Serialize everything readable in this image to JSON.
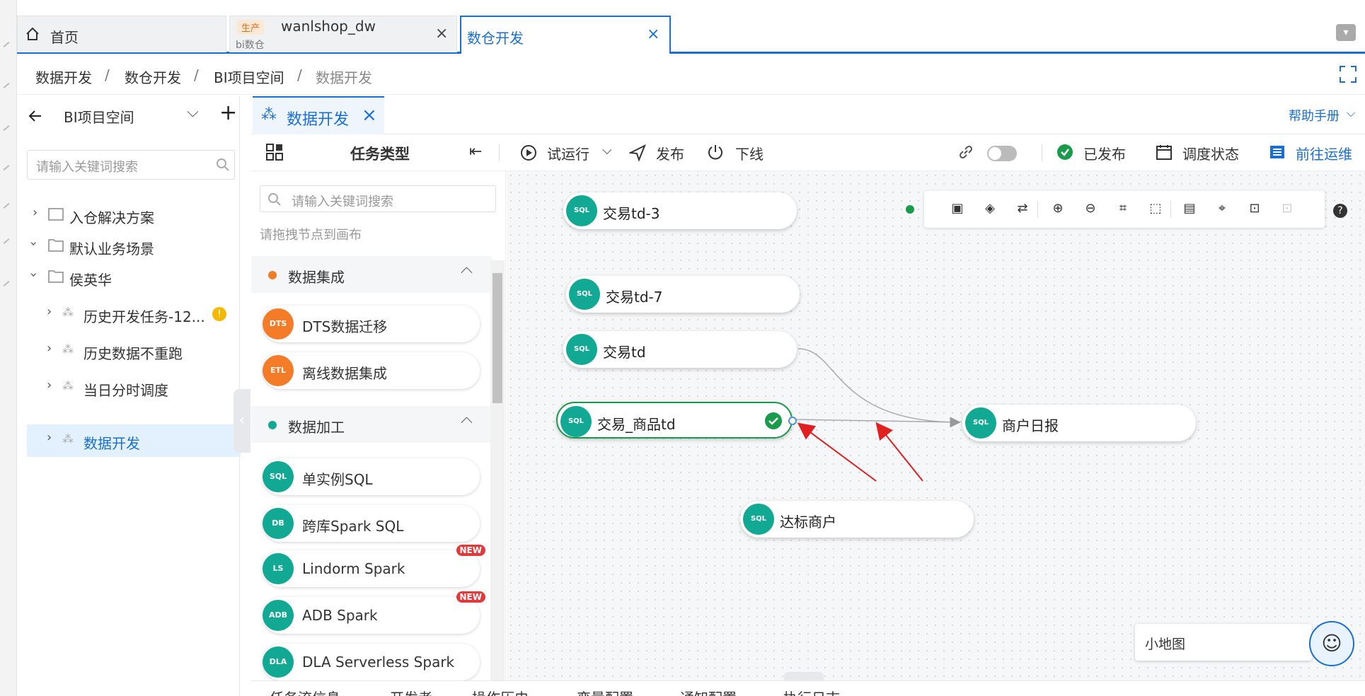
{
  "tabs": {
    "home": "首页",
    "env_badge": "生产",
    "project_name": "wanlshop_dw",
    "project_sub": "bi数仓",
    "active": "数仓开发"
  },
  "breadcrumb": [
    "数据开发",
    "数仓开发",
    "BI项目空间",
    "数据开发"
  ],
  "sidebar": {
    "workspace": "BI项目空间",
    "search_placeholder": "请输入关键词搜索",
    "items": [
      {
        "label": "入仓解决方案"
      },
      {
        "label": "默认业务场景"
      },
      {
        "label": "侯英华"
      },
      {
        "label": "历史开发任务-12..."
      },
      {
        "label": "历史数据不重跑"
      },
      {
        "label": "当日分时调度"
      },
      {
        "label": "数据开发"
      }
    ]
  },
  "work_tab": "数据开发",
  "help": "帮助手册",
  "toolbar": {
    "task_type": "任务类型",
    "trial_run": "试运行",
    "publish": "发布",
    "offline": "下线",
    "published": "已发布",
    "schedule_status": "调度状态",
    "goto_ops": "前往运维"
  },
  "palette": {
    "search_placeholder": "请输入关键词搜索",
    "hint": "请拖拽节点到画布",
    "groups": [
      {
        "title": "数据集成",
        "color": "#f47c28",
        "items": [
          {
            "label": "DTS数据迁移"
          },
          {
            "label": "离线数据集成"
          }
        ]
      },
      {
        "title": "数据加工",
        "color": "#11a894",
        "items": [
          {
            "label": "单实例SQL"
          },
          {
            "label": "跨库Spark SQL"
          },
          {
            "label": "Lindorm Spark",
            "badge": "NEW"
          },
          {
            "label": "ADB Spark",
            "badge": "NEW"
          },
          {
            "label": "DLA Serverless Spark"
          }
        ]
      }
    ]
  },
  "canvas": {
    "nodes": [
      {
        "label": "交易td-3"
      },
      {
        "label": "交易td-7"
      },
      {
        "label": "交易td"
      },
      {
        "label": "交易_商品td"
      },
      {
        "label": "商户日报"
      },
      {
        "label": "达标商户"
      }
    ],
    "minimap": "小地图"
  },
  "bottom_tabs": [
    "任务流信息",
    "开发者",
    "操作历史",
    "变量配置",
    "通知配置",
    "执行日志"
  ],
  "colors": {
    "accent": "#1a6fd4",
    "teal": "#11a894",
    "orange": "#f47c28",
    "success": "#1a9b4b",
    "arrow_red": "#e02020"
  },
  "icons": [
    "home-icon",
    "close-icon",
    "back-arrow-icon",
    "plus-icon",
    "search-icon",
    "folder-icon",
    "task-flow-icon",
    "grid-icon",
    "list-indent-icon",
    "play-icon",
    "send-icon",
    "power-icon",
    "link-icon",
    "check-circle-icon",
    "calendar-icon",
    "ops-icon",
    "save-icon",
    "layers-icon",
    "swap-icon",
    "zoom-in-icon",
    "zoom-out-icon",
    "crop-icon",
    "select-icon",
    "panel-icon",
    "tag-icon",
    "lock-icon",
    "unlock-icon",
    "help-icon",
    "fullscreen-icon"
  ]
}
